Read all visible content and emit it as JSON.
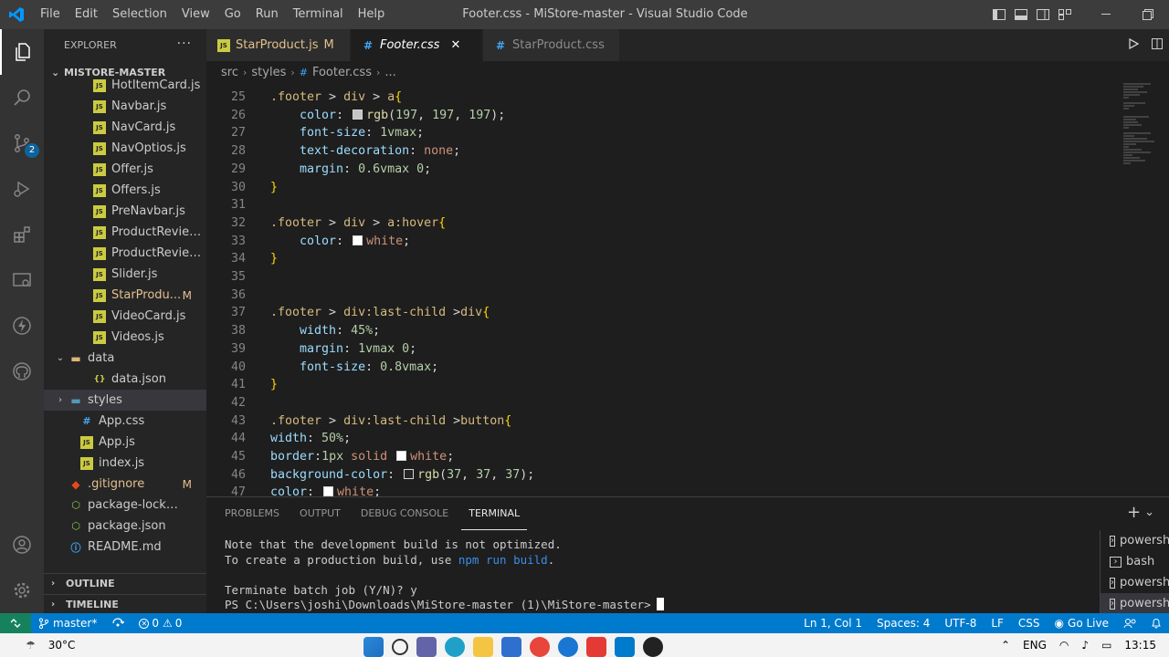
{
  "window": {
    "title": "Footer.css - MiStore-master - Visual Studio Code",
    "menu": [
      "File",
      "Edit",
      "Selection",
      "View",
      "Go",
      "Run",
      "Terminal",
      "Help"
    ]
  },
  "activity": {
    "scm_badge": "2"
  },
  "sidebar": {
    "header": "EXPLORER",
    "more": "···",
    "project": "MISTORE-MASTER",
    "tree": [
      {
        "label": "HotItemCard.js",
        "type": "js",
        "indent": 54
      },
      {
        "label": "Navbar.js",
        "type": "js",
        "indent": 54
      },
      {
        "label": "NavCard.js",
        "type": "js",
        "indent": 54
      },
      {
        "label": "NavOptios.js",
        "type": "js",
        "indent": 54
      },
      {
        "label": "Offer.js",
        "type": "js",
        "indent": 54
      },
      {
        "label": "Offers.js",
        "type": "js",
        "indent": 54
      },
      {
        "label": "PreNavbar.js",
        "type": "js",
        "indent": 54
      },
      {
        "label": "ProductReview...",
        "type": "js",
        "indent": 54
      },
      {
        "label": "ProductReview...",
        "type": "js",
        "indent": 54
      },
      {
        "label": "Slider.js",
        "type": "js",
        "indent": 54
      },
      {
        "label": "StarProdu...",
        "type": "js",
        "indent": 54,
        "modified": "M"
      },
      {
        "label": "VideoCard.js",
        "type": "js",
        "indent": 54
      },
      {
        "label": "Videos.js",
        "type": "js",
        "indent": 54
      },
      {
        "label": "data",
        "type": "folder",
        "indent": 28,
        "chevron": "v"
      },
      {
        "label": "data.json",
        "type": "json",
        "indent": 54
      },
      {
        "label": "styles",
        "type": "folderblue",
        "indent": 28,
        "chevron": ">",
        "selected": true
      },
      {
        "label": "App.css",
        "type": "css",
        "indent": 40
      },
      {
        "label": "App.js",
        "type": "js",
        "indent": 40
      },
      {
        "label": "index.js",
        "type": "js",
        "indent": 40
      },
      {
        "label": ".gitignore",
        "type": "git",
        "indent": 28,
        "modified": "M"
      },
      {
        "label": "package-lock.json",
        "type": "npm",
        "indent": 28
      },
      {
        "label": "package.json",
        "type": "npm",
        "indent": 28
      },
      {
        "label": "README.md",
        "type": "md",
        "indent": 28
      }
    ],
    "outline": "OUTLINE",
    "timeline": "TIMELINE"
  },
  "tabs": [
    {
      "label": "StarProduct.js",
      "type": "js",
      "modified": "M",
      "active": false
    },
    {
      "label": "Footer.css",
      "type": "css",
      "active": true,
      "close": "✕"
    },
    {
      "label": "StarProduct.css",
      "type": "css",
      "active": false
    }
  ],
  "breadcrumb": [
    "src",
    "styles",
    "Footer.css",
    "..."
  ],
  "editor": {
    "lines": [
      {
        "n": "25",
        "tokens": [
          [
            "sel",
            ".footer "
          ],
          [
            "pun",
            "> "
          ],
          [
            "sel",
            "div "
          ],
          [
            "pun",
            "> "
          ],
          [
            "sel",
            "a"
          ],
          [
            "brace",
            "{"
          ]
        ]
      },
      {
        "n": "26",
        "tokens": [
          [
            "pun",
            "    "
          ],
          [
            "prop",
            "color"
          ],
          [
            "pun",
            ": "
          ],
          [
            "swatch",
            "#c5c5c5"
          ],
          [
            "fn",
            "rgb"
          ],
          [
            "pun",
            "("
          ],
          [
            "num",
            "197"
          ],
          [
            "pun",
            ", "
          ],
          [
            "num",
            "197"
          ],
          [
            "pun",
            ", "
          ],
          [
            "num",
            "197"
          ],
          [
            "pun",
            ");"
          ]
        ]
      },
      {
        "n": "27",
        "tokens": [
          [
            "pun",
            "    "
          ],
          [
            "prop",
            "font-size"
          ],
          [
            "pun",
            ": "
          ],
          [
            "num",
            "1vmax"
          ],
          [
            "pun",
            ";"
          ]
        ]
      },
      {
        "n": "28",
        "tokens": [
          [
            "pun",
            "    "
          ],
          [
            "prop",
            "text-decoration"
          ],
          [
            "pun",
            ": "
          ],
          [
            "val",
            "none"
          ],
          [
            "pun",
            ";"
          ]
        ]
      },
      {
        "n": "29",
        "tokens": [
          [
            "pun",
            "    "
          ],
          [
            "prop",
            "margin"
          ],
          [
            "pun",
            ": "
          ],
          [
            "num",
            "0.6vmax"
          ],
          [
            "pun",
            " "
          ],
          [
            "num",
            "0"
          ],
          [
            "pun",
            ";"
          ]
        ]
      },
      {
        "n": "30",
        "tokens": [
          [
            "brace",
            "}"
          ]
        ]
      },
      {
        "n": "31",
        "tokens": []
      },
      {
        "n": "32",
        "tokens": [
          [
            "sel",
            ".footer "
          ],
          [
            "pun",
            "> "
          ],
          [
            "sel",
            "div "
          ],
          [
            "pun",
            "> "
          ],
          [
            "sel",
            "a:hover"
          ],
          [
            "brace",
            "{"
          ]
        ]
      },
      {
        "n": "33",
        "tokens": [
          [
            "pun",
            "    "
          ],
          [
            "prop",
            "color"
          ],
          [
            "pun",
            ": "
          ],
          [
            "swatch",
            "#ffffff"
          ],
          [
            "val",
            "white"
          ],
          [
            "pun",
            ";"
          ]
        ]
      },
      {
        "n": "34",
        "tokens": [
          [
            "brace",
            "}"
          ]
        ]
      },
      {
        "n": "35",
        "tokens": []
      },
      {
        "n": "36",
        "tokens": []
      },
      {
        "n": "37",
        "tokens": [
          [
            "sel",
            ".footer "
          ],
          [
            "pun",
            "> "
          ],
          [
            "sel",
            "div:last-child "
          ],
          [
            "pun",
            ">"
          ],
          [
            "sel",
            "div"
          ],
          [
            "brace",
            "{"
          ]
        ]
      },
      {
        "n": "38",
        "tokens": [
          [
            "pun",
            "    "
          ],
          [
            "prop",
            "width"
          ],
          [
            "pun",
            ": "
          ],
          [
            "num",
            "45%"
          ],
          [
            "pun",
            ";"
          ]
        ]
      },
      {
        "n": "39",
        "tokens": [
          [
            "pun",
            "    "
          ],
          [
            "prop",
            "margin"
          ],
          [
            "pun",
            ": "
          ],
          [
            "num",
            "1vmax"
          ],
          [
            "pun",
            " "
          ],
          [
            "num",
            "0"
          ],
          [
            "pun",
            ";"
          ]
        ]
      },
      {
        "n": "40",
        "tokens": [
          [
            "pun",
            "    "
          ],
          [
            "prop",
            "font-size"
          ],
          [
            "pun",
            ": "
          ],
          [
            "num",
            "0.8vmax"
          ],
          [
            "pun",
            ";"
          ]
        ]
      },
      {
        "n": "41",
        "tokens": [
          [
            "brace",
            "}"
          ]
        ]
      },
      {
        "n": "42",
        "tokens": []
      },
      {
        "n": "43",
        "tokens": [
          [
            "sel",
            ".footer "
          ],
          [
            "pun",
            "> "
          ],
          [
            "sel",
            "div:last-child "
          ],
          [
            "pun",
            ">"
          ],
          [
            "sel",
            "button"
          ],
          [
            "brace",
            "{"
          ]
        ]
      },
      {
        "n": "44",
        "tokens": [
          [
            "prop",
            "width"
          ],
          [
            "pun",
            ": "
          ],
          [
            "num",
            "50%"
          ],
          [
            "pun",
            ";"
          ]
        ]
      },
      {
        "n": "45",
        "tokens": [
          [
            "prop",
            "border"
          ],
          [
            "pun",
            ":"
          ],
          [
            "num",
            "1px"
          ],
          [
            "pun",
            " "
          ],
          [
            "val",
            "solid"
          ],
          [
            "pun",
            " "
          ],
          [
            "swatch",
            "#ffffff"
          ],
          [
            "val",
            "white"
          ],
          [
            "pun",
            ";"
          ]
        ]
      },
      {
        "n": "46",
        "tokens": [
          [
            "prop",
            "background-color"
          ],
          [
            "pun",
            ": "
          ],
          [
            "swatch",
            "#252525"
          ],
          [
            "fn",
            "rgb"
          ],
          [
            "pun",
            "("
          ],
          [
            "num",
            "37"
          ],
          [
            "pun",
            ", "
          ],
          [
            "num",
            "37"
          ],
          [
            "pun",
            ", "
          ],
          [
            "num",
            "37"
          ],
          [
            "pun",
            ");"
          ]
        ]
      },
      {
        "n": "47",
        "tokens": [
          [
            "prop",
            "color"
          ],
          [
            "pun",
            ": "
          ],
          [
            "swatch",
            "#ffffff"
          ],
          [
            "val",
            "white"
          ],
          [
            "pun",
            ";"
          ]
        ]
      }
    ]
  },
  "panel": {
    "tabs": [
      "PROBLEMS",
      "OUTPUT",
      "DEBUG CONSOLE",
      "TERMINAL"
    ],
    "active_tab": "TERMINAL",
    "add": "+",
    "dropdown": "⌄",
    "terminal": {
      "line1": "Note that the development build is not optimized.",
      "line2_pre": "To create a production build, use ",
      "line2_cmd": "npm run build",
      "line2_post": ".",
      "line4": "Terminate batch job (Y/N)? y",
      "prompt": "PS C:\\Users\\joshi\\Downloads\\MiStore-master (1)\\MiStore-master>"
    },
    "terminals": [
      {
        "label": "powersh",
        "selected": false
      },
      {
        "label": "bash",
        "selected": false
      },
      {
        "label": "powersh",
        "selected": false
      },
      {
        "label": "powersh",
        "selected": true
      }
    ]
  },
  "statusbar": {
    "branch": "master*",
    "errors": "0",
    "warnings": "0",
    "position": "Ln 1, Col 1",
    "spaces": "Spaces: 4",
    "encoding": "UTF-8",
    "eol": "LF",
    "language": "CSS",
    "golive": "Go Live"
  },
  "taskbar": {
    "weather": "30°C",
    "lang": "ENG",
    "time": "13:15"
  },
  "colors": {
    "accent": "#007acc",
    "js_icon": "#cbcb41",
    "css_icon": "#42a5f5",
    "modified": "#e2c08d"
  }
}
